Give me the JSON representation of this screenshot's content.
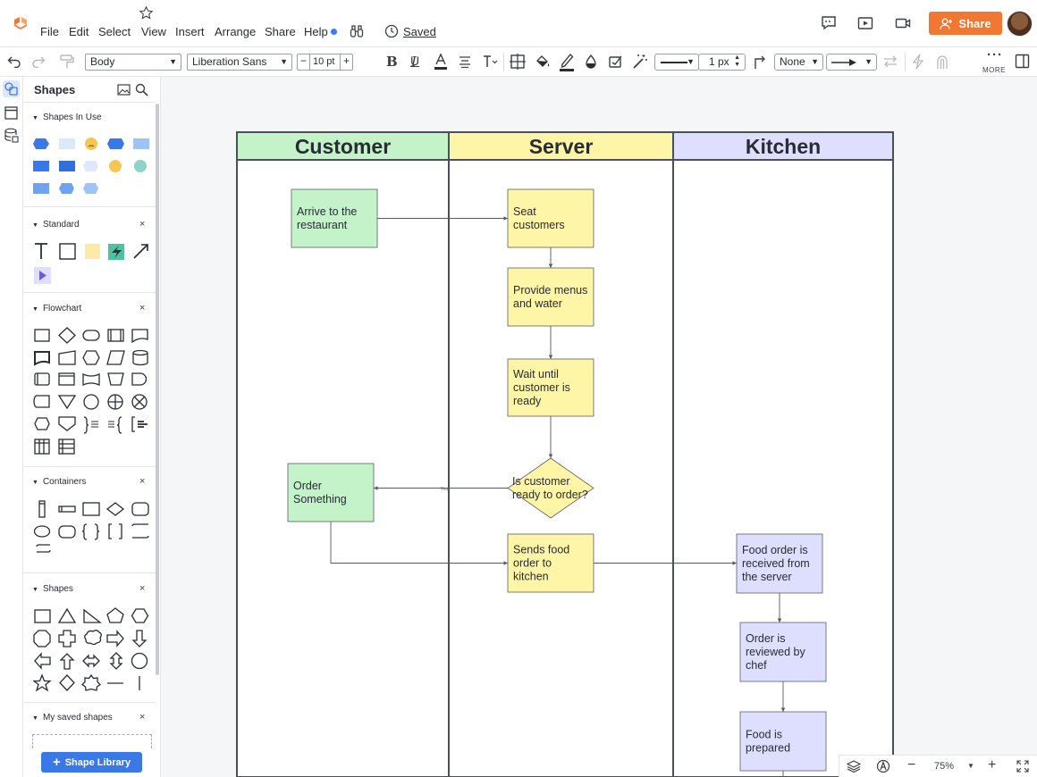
{
  "menu": {
    "items": [
      "File",
      "Edit",
      "Select",
      "View",
      "Insert",
      "Arrange",
      "Share",
      "Help"
    ],
    "saved_label": "Saved"
  },
  "share": {
    "label": "Share",
    "color": "#f27732"
  },
  "toolbar": {
    "style_select": "Body",
    "font_select": "Liberation Sans",
    "font_size": "10 pt",
    "line_width": "1 px",
    "line_end": "None",
    "more_label": "MORE"
  },
  "panel": {
    "title": "Shapes",
    "sections": [
      {
        "label": "Shapes In Use",
        "closable": false
      },
      {
        "label": "Standard",
        "closable": true
      },
      {
        "label": "Flowchart",
        "closable": true
      },
      {
        "label": "Containers",
        "closable": true
      },
      {
        "label": "Shapes",
        "closable": true
      },
      {
        "label": "My saved shapes",
        "closable": true
      }
    ],
    "library_button": "Shape Library",
    "close_glyph": "×"
  },
  "diagram": {
    "lanes": [
      {
        "label": "Customer",
        "color": "#c4f2c9"
      },
      {
        "label": "Server",
        "color": "#fff5a6"
      },
      {
        "label": "Kitchen",
        "color": "#dedfff"
      }
    ],
    "nodes": [
      {
        "id": "arrive",
        "lines": [
          "Arrive to the",
          "restaurant"
        ],
        "lane": "Customer"
      },
      {
        "id": "seat",
        "lines": [
          "Seat",
          "customers"
        ],
        "lane": "Server"
      },
      {
        "id": "menus",
        "lines": [
          "Provide menus",
          "and water"
        ],
        "lane": "Server"
      },
      {
        "id": "wait",
        "lines": [
          "Wait until",
          "customer is",
          "ready"
        ],
        "lane": "Server"
      },
      {
        "id": "ready",
        "lines": [
          "Is customer",
          "ready to order?"
        ],
        "lane": "Server",
        "shape": "decision"
      },
      {
        "id": "order",
        "lines": [
          "Order",
          "Something"
        ],
        "lane": "Customer"
      },
      {
        "id": "sends",
        "lines": [
          "Sends food",
          "order to",
          "kitchen"
        ],
        "lane": "Server"
      },
      {
        "id": "received",
        "lines": [
          "Food order is",
          "received from",
          "the server"
        ],
        "lane": "Kitchen"
      },
      {
        "id": "reviewed",
        "lines": [
          "Order is",
          "reviewed by",
          "chef"
        ],
        "lane": "Kitchen"
      },
      {
        "id": "prepared",
        "lines": [
          "Food is",
          "prepared"
        ],
        "lane": "Kitchen"
      }
    ],
    "edge_label_yes": "Yes"
  },
  "zoom": {
    "level": "75%"
  }
}
